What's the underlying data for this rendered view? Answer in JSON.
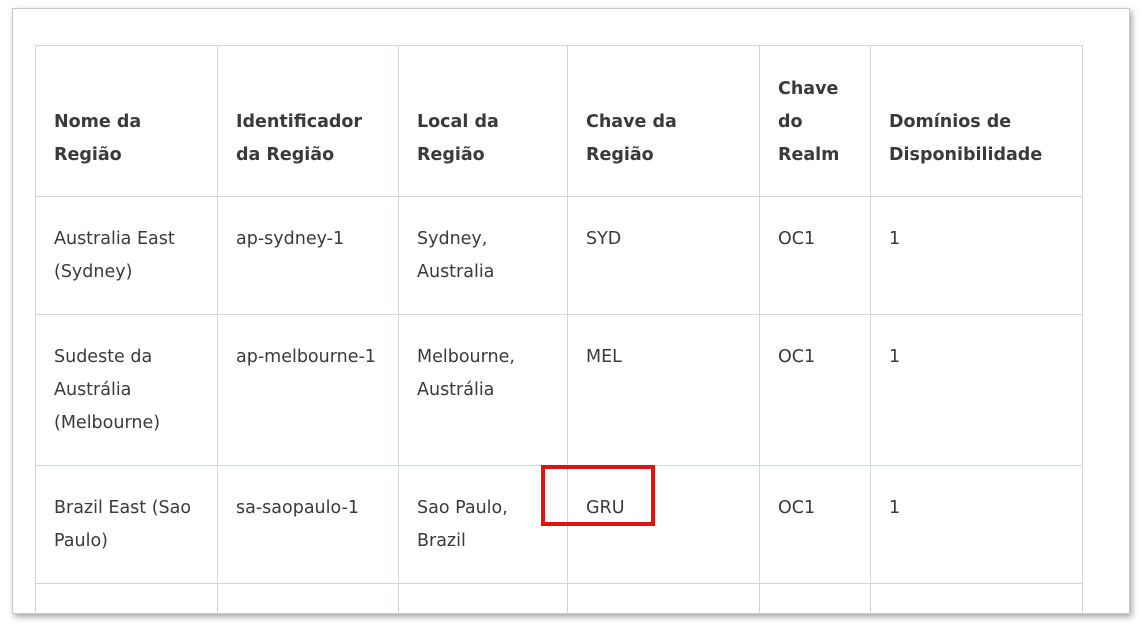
{
  "table": {
    "headers": [
      "Nome da Região",
      "Identificador da Região",
      "Local da Região",
      "Chave da Região",
      "Chave do Realm",
      "Domínios de Disponibilidade"
    ],
    "rows": [
      [
        "Australia East (Sydney)",
        "ap-sydney-1",
        "Sydney, Australia",
        "SYD",
        "OC1",
        "1"
      ],
      [
        "Sudeste da Austrália (Melbourne)",
        "ap-melbourne-1",
        "Melbourne, Austrália",
        "MEL",
        "OC1",
        "1"
      ],
      [
        "Brazil East (Sao Paulo)",
        "sa-saopaulo-1",
        "Sao Paulo, Brazil",
        "GRU",
        "OC1",
        "1"
      ]
    ]
  },
  "highlight": {
    "color": "#e01212",
    "target_value": "GRU"
  }
}
